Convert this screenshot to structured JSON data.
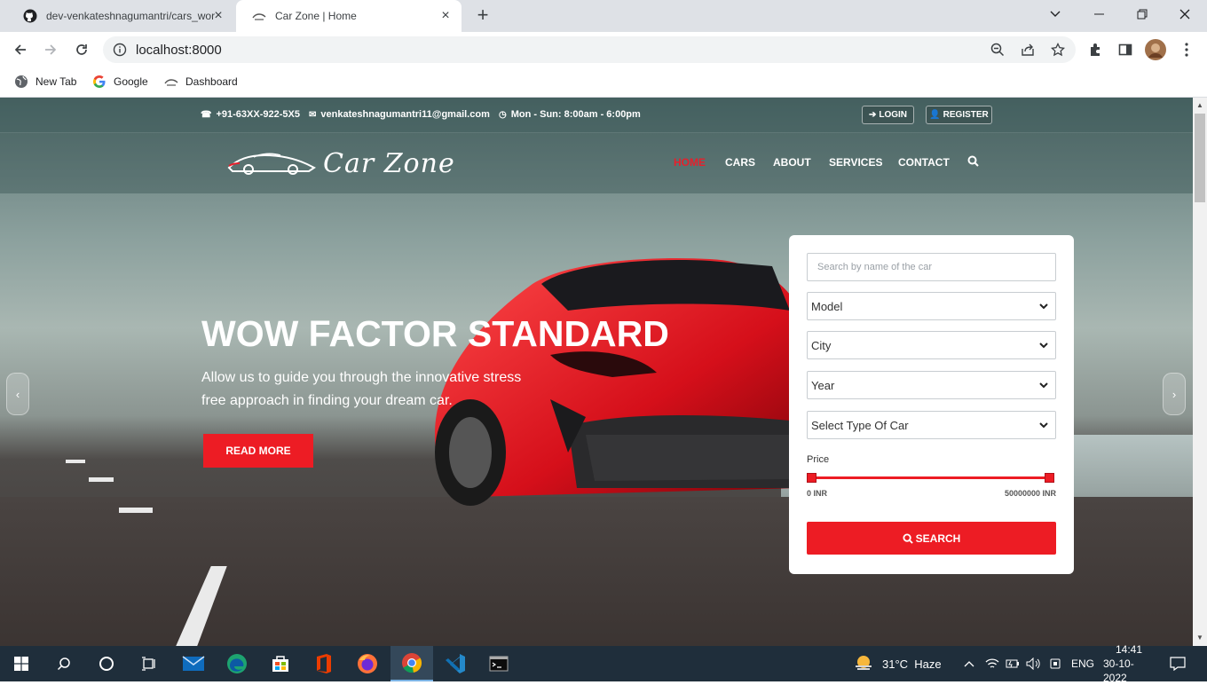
{
  "browser": {
    "tabs": [
      {
        "title": "dev-venkateshnagumantri/cars_wor"
      },
      {
        "title": "Car Zone | Home"
      }
    ],
    "url": "localhost:8000",
    "bookmarks": [
      {
        "label": "New Tab"
      },
      {
        "label": "Google"
      },
      {
        "label": "Dashboard"
      }
    ]
  },
  "site": {
    "topbar": {
      "phone": "+91-63XX-922-5X5",
      "email": "venkateshnagumantri11@gmail.com",
      "hours": "Mon - Sun: 8:00am - 6:00pm",
      "login": "LOGIN",
      "register": "REGISTER"
    },
    "logo": "Car Zone",
    "nav": [
      "HOME",
      "CARS",
      "ABOUT",
      "SERVICES",
      "CONTACT"
    ],
    "hero": {
      "title": "WOW FACTOR STANDARD",
      "subtitle_line1": "Allow us to guide you through the innovative stress",
      "subtitle_line2": "free approach in finding your dream car.",
      "cta": "READ MORE"
    },
    "search_panel": {
      "placeholder": "Search by name of the car",
      "model": "Model",
      "city": "City",
      "year": "Year",
      "type": "Select Type Of Car",
      "price_label": "Price",
      "price_min": "0 INR",
      "price_max": "50000000 INR",
      "price_range_fraction": [
        0,
        1
      ],
      "button": "SEARCH"
    }
  },
  "taskbar": {
    "weather": "31°C  Haze",
    "lang": "ENG",
    "time": "14:41",
    "date": "30-10-2022"
  },
  "colors": {
    "accent": "#ed1c24",
    "taskbar": "#1f2e3b",
    "tabstrip": "#dee1e6"
  }
}
